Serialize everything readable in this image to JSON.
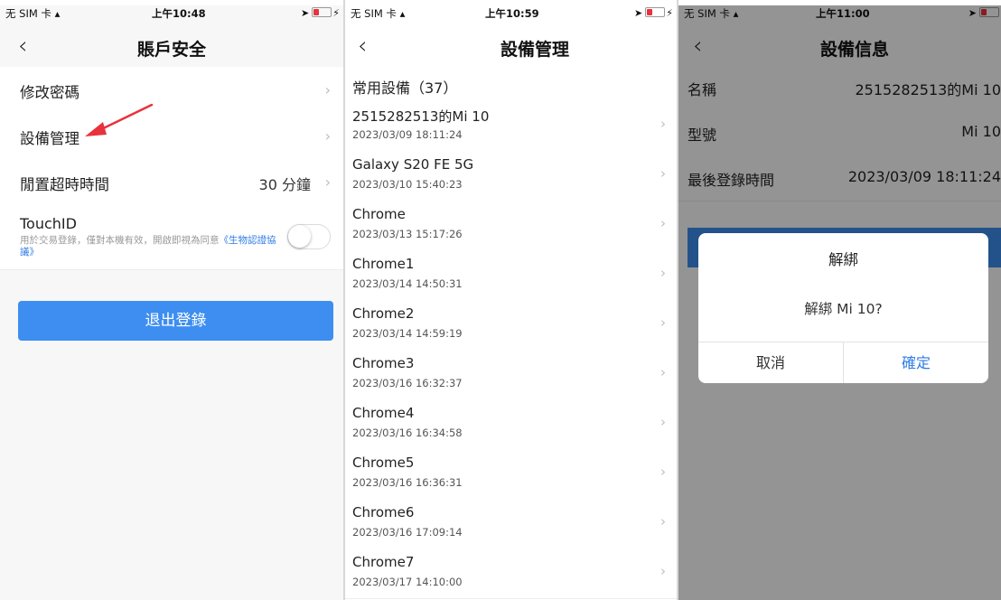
{
  "status_bar": [
    {
      "carrier": "无 SIM 卡",
      "time": "上午10:48"
    },
    {
      "carrier": "无 SIM 卡",
      "time": "上午10:59"
    },
    {
      "carrier": "无 SIM 卡",
      "time": "上午11:00"
    }
  ],
  "account_security": {
    "title": "賬戶安全",
    "change_password": "修改密碼",
    "device_management": "設備管理",
    "idle_timeout_label": "閒置超時時間",
    "idle_timeout_value": "30 分鐘",
    "touchid_title": "TouchID",
    "touchid_desc": "用於交易登錄，僅對本機有效，開啟即視為同意",
    "touchid_link": "《生物認證協議》",
    "touchid_enabled": false,
    "logout_label": "退出登錄"
  },
  "device_management": {
    "title": "設備管理",
    "section_header": "常用設備（37）",
    "devices": [
      {
        "name": "2515282513的Mi 10",
        "time": "2023/03/09 18:11:24"
      },
      {
        "name": "Galaxy S20 FE 5G",
        "time": "2023/03/10 15:40:23"
      },
      {
        "name": "Chrome",
        "time": "2023/03/13 15:17:26"
      },
      {
        "name": "Chrome1",
        "time": "2023/03/14 14:50:31"
      },
      {
        "name": "Chrome2",
        "time": "2023/03/14 14:59:19"
      },
      {
        "name": "Chrome3",
        "time": "2023/03/16 16:32:37"
      },
      {
        "name": "Chrome4",
        "time": "2023/03/16 16:34:58"
      },
      {
        "name": "Chrome5",
        "time": "2023/03/16 16:36:31"
      },
      {
        "name": "Chrome6",
        "time": "2023/03/16 17:09:14"
      },
      {
        "name": "Chrome7",
        "time": "2023/03/17 14:10:00"
      }
    ]
  },
  "device_info": {
    "title": "設備信息",
    "rows": [
      {
        "key": "名稱",
        "value": "2515282513的Mi 10"
      },
      {
        "key": "型號",
        "value": "Mi 10"
      },
      {
        "key": "最後登錄時間",
        "value": "2023/03/09 18:11:24"
      }
    ],
    "dialog": {
      "title": "解綁",
      "message": "解綁 Mi 10?",
      "cancel": "取消",
      "confirm": "確定"
    }
  },
  "colors": {
    "primary_blue": "#3d8ef0",
    "link_blue": "#2c7be5",
    "annotation_arrow": "#e8323c"
  }
}
